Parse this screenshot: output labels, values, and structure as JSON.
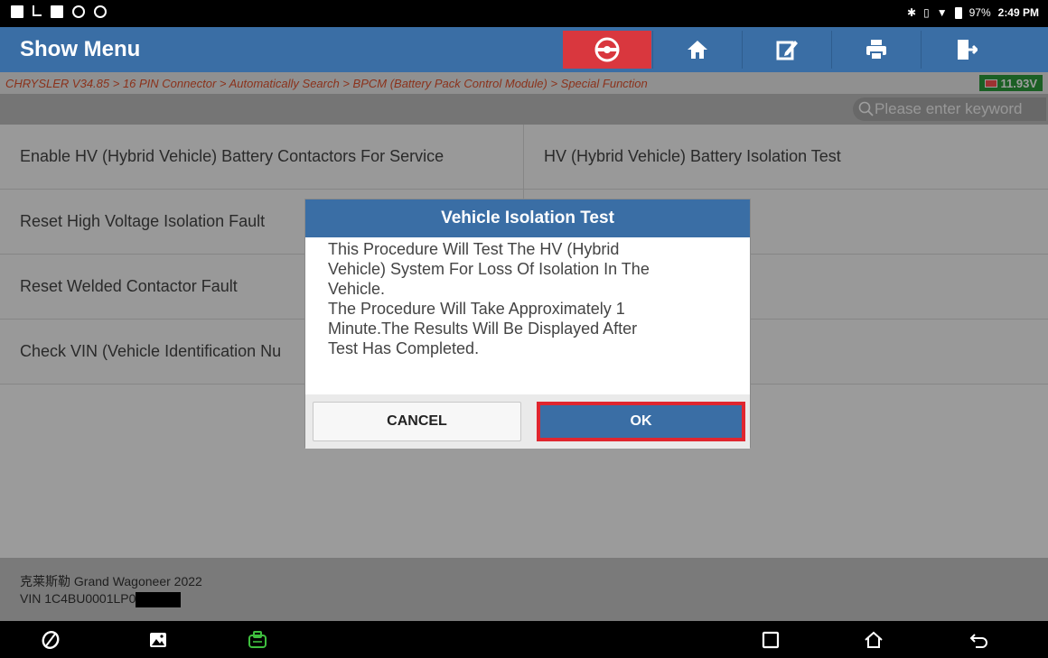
{
  "status_bar": {
    "battery": "97%",
    "time": "2:49 PM"
  },
  "toolbar": {
    "title": "Show Menu",
    "buttons": [
      "steering-wheel",
      "home",
      "edit",
      "print",
      "exit"
    ]
  },
  "breadcrumb": {
    "path": "CHRYSLER V34.85 > 16 PIN Connector > Automatically Search > BPCM (Battery Pack Control Module) > Special Function",
    "voltage": "11.93V"
  },
  "search": {
    "placeholder": "Please enter keyword"
  },
  "menu": {
    "items": [
      "Enable HV (Hybrid Vehicle) Battery Contactors For Service",
      "HV (Hybrid Vehicle) Battery Isolation Test",
      "Reset High Voltage Isolation Fault",
      "",
      "Reset Welded Contactor Fault",
      "",
      "Check VIN (Vehicle Identification Nu",
      ""
    ]
  },
  "footer": {
    "car": "克莱斯勒 Grand Wagoneer 2022",
    "vin": "VIN 1C4BU0001LP0"
  },
  "dialog": {
    "title": "Vehicle Isolation Test",
    "body": "This Procedure Will Test The HV (Hybrid\nVehicle) System For Loss Of Isolation In The\nVehicle.\nThe Procedure Will Take Approximately 1\nMinute.The Results Will Be Displayed After\nTest Has Completed.",
    "cancel_label": "CANCEL",
    "ok_label": "OK"
  },
  "colors": {
    "header_blue": "#3a6ea5",
    "highlight_red": "#e0262f",
    "breadcrumb_orange": "#e0522d",
    "voltage_green": "#2c9a3a"
  }
}
